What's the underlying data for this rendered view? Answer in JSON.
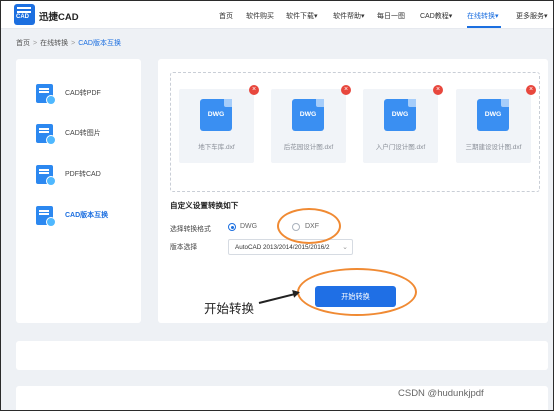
{
  "header": {
    "brand": "迅捷CAD",
    "logo_text": "CAD",
    "nav": [
      {
        "label": "首页",
        "active": false
      },
      {
        "label": "软件购买",
        "active": false
      },
      {
        "label": "软件下载▾",
        "active": false
      },
      {
        "label": "软件帮助▾",
        "active": false
      },
      {
        "label": "每日一图",
        "active": false
      },
      {
        "label": "CAD教程▾",
        "active": false
      },
      {
        "label": "在线转换▾",
        "active": true
      },
      {
        "label": "更多服务▾",
        "active": false
      }
    ]
  },
  "breadcrumb": {
    "items": [
      "首页",
      "在线转换",
      "CAD版本互换"
    ],
    "separator": ">"
  },
  "sidebar": {
    "items": [
      {
        "label": "CAD转PDF",
        "icon": "cad-to-pdf-icon",
        "active": false
      },
      {
        "label": "CAD转图片",
        "icon": "cad-to-image-icon",
        "active": false
      },
      {
        "label": "PDF转CAD",
        "icon": "pdf-to-cad-icon",
        "active": false
      },
      {
        "label": "CAD版本互换",
        "icon": "cad-version-convert-icon",
        "active": true
      }
    ]
  },
  "files": [
    {
      "badge": "DWG",
      "name": "地下车库.dxf"
    },
    {
      "badge": "DWG",
      "name": "后花园设计图.dxf"
    },
    {
      "badge": "DWG",
      "name": "入户门设计图.dxf"
    },
    {
      "badge": "DWG",
      "name": "三期建设设计图.dxf"
    }
  ],
  "settings": {
    "title": "自定义设置转换如下",
    "format_label": "选择转换格式",
    "formats": [
      {
        "label": "DWG",
        "checked": true
      },
      {
        "label": "DXF",
        "checked": false
      }
    ],
    "version_label": "版本选择",
    "version_value": "AutoCAD 2013/2014/2015/2016/2",
    "start_button": "开始转换"
  },
  "annotation": {
    "callout": "开始转换",
    "color": "#f08a33"
  },
  "watermark": "CSDN @hudunkjpdf",
  "colors": {
    "accent": "#1c6fe0",
    "remove": "#e8473d",
    "page_bg": "#eef1f5"
  }
}
